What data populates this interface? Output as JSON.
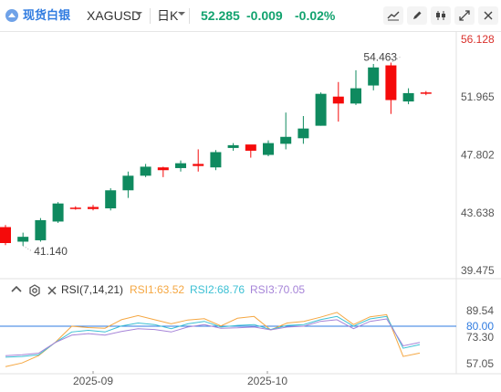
{
  "header": {
    "brand": "现货白银",
    "symbol": "XAGUSD",
    "dropdown_icon": "caret-down-icon",
    "period": "日K",
    "period_dropdown_icon": "caret-down-icon",
    "price": "52.285",
    "change": "-0.009",
    "change_pct": "-0.02%",
    "tools": [
      "line-chart-icon",
      "pencil-icon",
      "candlestick-icon",
      "expand-icon",
      "close-icon"
    ],
    "price_color": "#13a36f"
  },
  "chart_data": [
    {
      "type": "candlestick",
      "title": "",
      "up_color": "#0f8a5f",
      "down_color": "#f50a0a",
      "y_axis": {
        "ticks": [
          "56.128",
          "51.965",
          "47.802",
          "43.638",
          "39.475"
        ],
        "range": [
          39.475,
          56.128
        ],
        "side": "right"
      },
      "annotations": {
        "high": "54.463",
        "low": "41.140"
      },
      "candles": [
        {
          "o": 42.6,
          "h": 42.75,
          "l": 41.3,
          "c": 41.45
        },
        {
          "o": 41.55,
          "h": 42.2,
          "l": 41.25,
          "c": 41.9
        },
        {
          "o": 41.65,
          "h": 43.25,
          "l": 41.55,
          "c": 43.1
        },
        {
          "o": 43.0,
          "h": 44.4,
          "l": 42.9,
          "c": 44.3
        },
        {
          "o": 44.0,
          "h": 44.1,
          "l": 43.85,
          "c": 43.95
        },
        {
          "o": 44.05,
          "h": 44.2,
          "l": 43.8,
          "c": 43.9
        },
        {
          "o": 43.95,
          "h": 45.4,
          "l": 43.8,
          "c": 45.25
        },
        {
          "o": 45.25,
          "h": 46.6,
          "l": 44.7,
          "c": 46.3
        },
        {
          "o": 46.3,
          "h": 47.15,
          "l": 46.2,
          "c": 46.95
        },
        {
          "o": 46.9,
          "h": 46.95,
          "l": 46.2,
          "c": 46.7
        },
        {
          "o": 46.85,
          "h": 47.4,
          "l": 46.6,
          "c": 47.2
        },
        {
          "o": 47.15,
          "h": 48.2,
          "l": 46.6,
          "c": 47.0
        },
        {
          "o": 46.9,
          "h": 48.15,
          "l": 46.7,
          "c": 48.0
        },
        {
          "o": 48.3,
          "h": 48.65,
          "l": 48.1,
          "c": 48.5
        },
        {
          "o": 48.55,
          "h": 48.5,
          "l": 47.6,
          "c": 48.1
        },
        {
          "o": 47.8,
          "h": 48.85,
          "l": 47.7,
          "c": 48.65
        },
        {
          "o": 48.6,
          "h": 50.85,
          "l": 48.2,
          "c": 49.1
        },
        {
          "o": 49.0,
          "h": 50.6,
          "l": 48.6,
          "c": 49.7
        },
        {
          "o": 49.9,
          "h": 52.3,
          "l": 49.9,
          "c": 52.2
        },
        {
          "o": 52.0,
          "h": 53.05,
          "l": 50.2,
          "c": 51.5
        },
        {
          "o": 51.5,
          "h": 53.9,
          "l": 51.4,
          "c": 52.6
        },
        {
          "o": 52.8,
          "h": 54.35,
          "l": 52.45,
          "c": 54.1
        },
        {
          "o": 54.25,
          "h": 54.45,
          "l": 50.75,
          "c": 51.75
        },
        {
          "o": 51.65,
          "h": 52.6,
          "l": 51.45,
          "c": 52.25
        },
        {
          "o": 52.3,
          "h": 52.4,
          "l": 52.1,
          "c": 52.285
        }
      ]
    },
    {
      "type": "line",
      "title": "RSI(7,14,21)",
      "x_ticks": [
        "2025-09",
        "2025-10"
      ],
      "y_axis": {
        "ticks": [
          "89.54",
          "80.00",
          "73.30",
          "57.05"
        ],
        "range": [
          57.05,
          89.54
        ],
        "side": "right"
      },
      "reference_line": 80.0,
      "series": [
        {
          "name": "RSI1:63.52",
          "color": "#f5a742",
          "values": [
            55.2,
            57.5,
            62.0,
            70.1,
            80.0,
            79.2,
            78.8,
            84.0,
            86.5,
            84.0,
            81.5,
            83.8,
            84.6,
            80.2,
            84.9,
            86.0,
            77.8,
            82.0,
            83.0,
            85.5,
            88.5,
            81.0,
            85.8,
            87.1,
            61.5,
            63.52
          ]
        },
        {
          "name": "RSI2:68.76",
          "color": "#3cc0d4",
          "values": [
            61.0,
            61.5,
            62.5,
            70.0,
            76.5,
            77.5,
            76.5,
            80.2,
            82.0,
            81.0,
            78.5,
            81.5,
            83.0,
            79.5,
            80.5,
            81.0,
            78.0,
            80.5,
            81.0,
            84.0,
            86.0,
            80.0,
            84.5,
            86.0,
            66.5,
            68.76
          ]
        },
        {
          "name": "RSI3:70.05",
          "color": "#a684d8",
          "values": [
            62.0,
            62.5,
            63.5,
            70.0,
            74.5,
            75.5,
            74.5,
            76.8,
            78.5,
            78.0,
            76.5,
            79.5,
            81.0,
            78.8,
            79.0,
            79.5,
            77.8,
            79.5,
            80.0,
            83.0,
            84.0,
            78.5,
            83.0,
            84.5,
            68.0,
            70.05
          ]
        }
      ]
    }
  ]
}
